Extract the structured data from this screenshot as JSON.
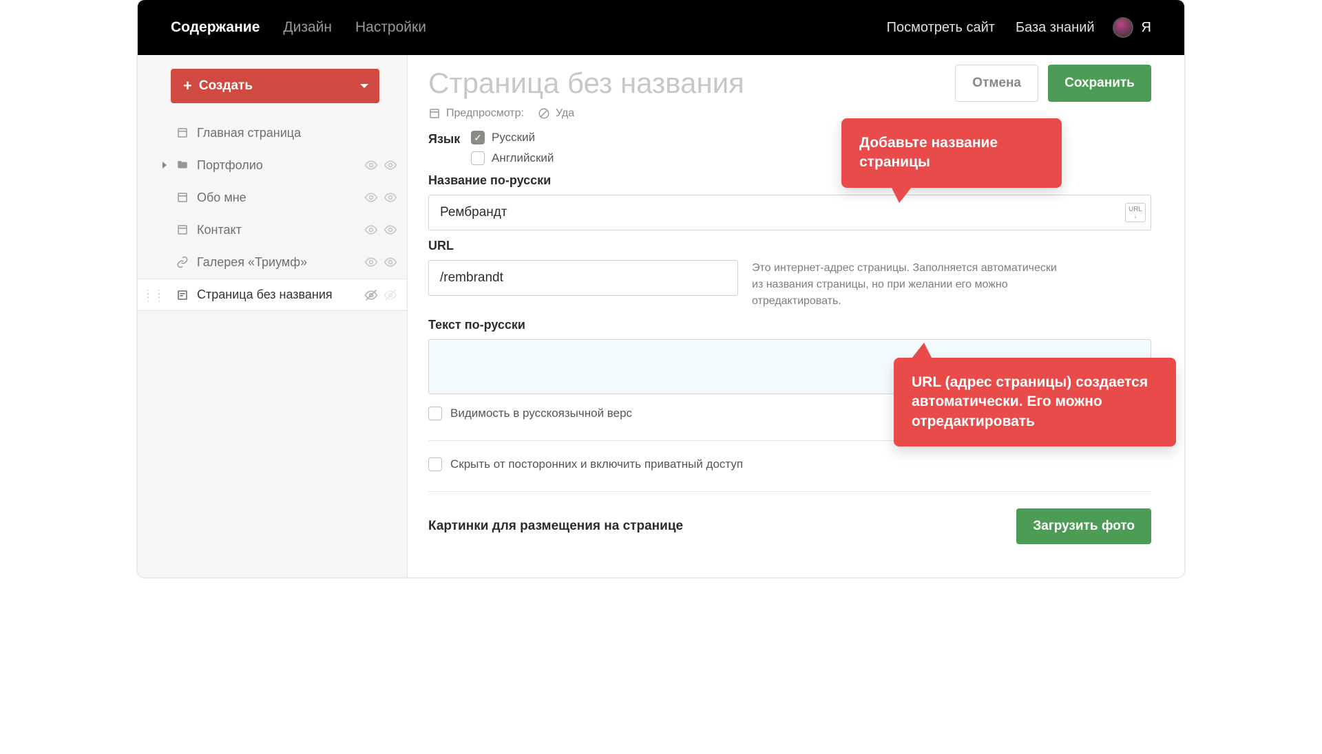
{
  "topbar": {
    "nav": [
      "Содержание",
      "Дизайн",
      "Настройки"
    ],
    "active_index": 0,
    "right": [
      "Посмотреть сайт",
      "База знаний"
    ],
    "user_initial": "Я"
  },
  "sidebar": {
    "create_label": "Создать",
    "items": [
      {
        "label": "Главная страница",
        "icon": "page",
        "has_children": false,
        "vis": false
      },
      {
        "label": "Портфолио",
        "icon": "folder",
        "has_children": true,
        "vis": true
      },
      {
        "label": "Обо мне",
        "icon": "page",
        "has_children": false,
        "vis": true
      },
      {
        "label": "Контакт",
        "icon": "page",
        "has_children": false,
        "vis": true
      },
      {
        "label": "Галерея «Триумф»",
        "icon": "link",
        "has_children": false,
        "vis": true
      },
      {
        "label": "Страница без названия",
        "icon": "textpage",
        "has_children": false,
        "vis": true,
        "active": true
      }
    ]
  },
  "main": {
    "title": "Страница без названия",
    "cancel": "Отмена",
    "save": "Сохранить",
    "tools": {
      "preview": "Предпросмотр:",
      "disable": "Уда"
    },
    "lang_label": "Язык",
    "lang_ru": "Русский",
    "lang_en": "Английский",
    "name_label": "Название по-русски",
    "name_value": "Рембрандт",
    "url_label": "URL",
    "url_value": "/rembrandt",
    "url_help": "Это интернет-адрес страницы. Заполняется автоматически из названия страницы, но при желании его можно отредактировать.",
    "url_btn_text": "URL",
    "text_label": "Текст по-русски",
    "visibility_label": "Видимость в русскоязычной верс",
    "private_label": "Скрыть от посторонних и включить приватный доступ",
    "images_title": "Картинки для размещения на странице",
    "upload_label": "Загрузить фото"
  },
  "tooltip1": "Добавьте название страницы",
  "tooltip2": "URL (адрес страницы) создается автоматически. Его можно отредактировать"
}
